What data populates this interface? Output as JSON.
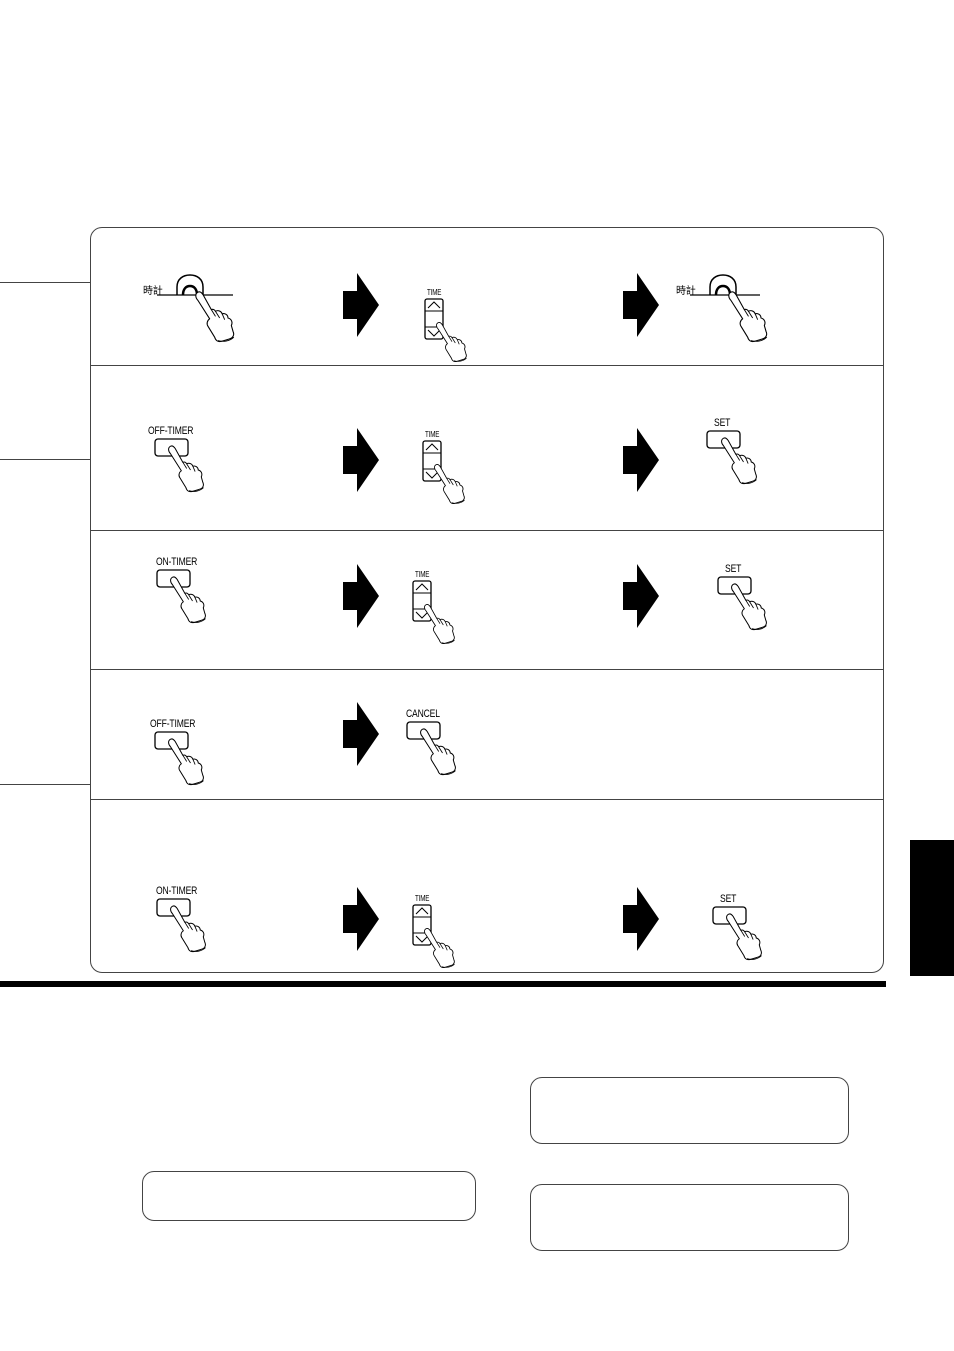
{
  "diagram": {
    "title": "",
    "rows": [
      {
        "id": "clock-set",
        "steps": [
          {
            "control": "clock-button",
            "label": "時計"
          },
          {
            "control": "time-rocker",
            "label": "TIME"
          },
          {
            "control": "clock-button",
            "label": "時計"
          }
        ]
      },
      {
        "id": "off-timer-set",
        "steps": [
          {
            "control": "push-button",
            "label": "OFF-TIMER"
          },
          {
            "control": "time-rocker",
            "label": "TIME"
          },
          {
            "control": "push-button",
            "label": "SET"
          }
        ]
      },
      {
        "id": "on-timer-set",
        "steps": [
          {
            "control": "push-button",
            "label": "ON-TIMER"
          },
          {
            "control": "time-rocker",
            "label": "TIME"
          },
          {
            "control": "push-button",
            "label": "SET"
          }
        ]
      },
      {
        "id": "off-timer-cancel",
        "steps": [
          {
            "control": "push-button",
            "label": "OFF-TIMER"
          },
          {
            "control": "push-button",
            "label": "CANCEL"
          }
        ]
      },
      {
        "id": "on-timer-set-2",
        "steps": [
          {
            "control": "push-button",
            "label": "ON-TIMER"
          },
          {
            "control": "time-rocker",
            "label": "TIME"
          },
          {
            "control": "push-button",
            "label": "SET"
          }
        ]
      }
    ],
    "arrow_icon": "right-arrow-icon",
    "hand_icon": "pointing-hand-icon"
  },
  "notes": {
    "left_box": "",
    "right_box_1": "",
    "right_box_2": ""
  },
  "colors": {
    "ink": "#000000",
    "line": "#444444",
    "background": "#ffffff"
  }
}
